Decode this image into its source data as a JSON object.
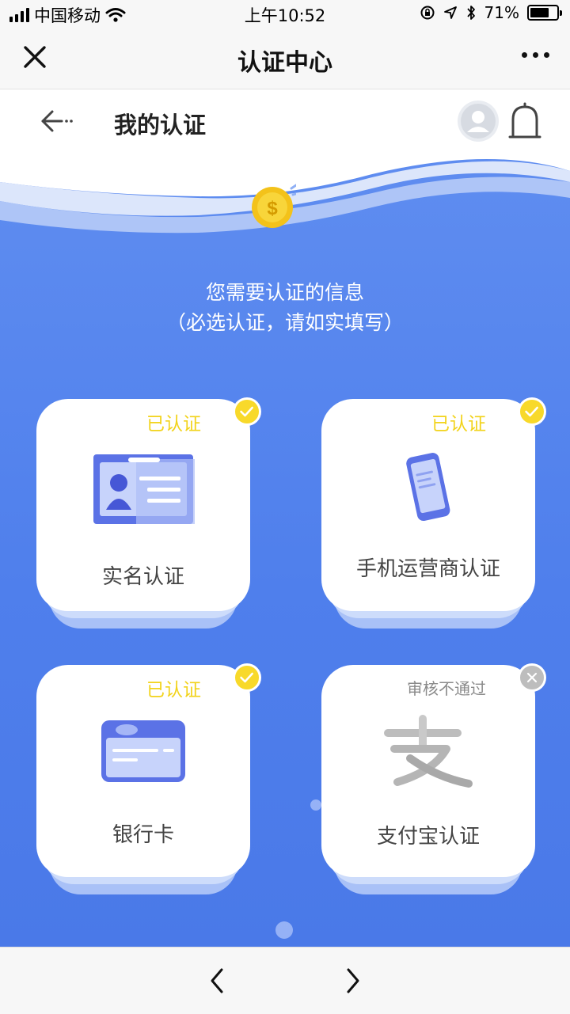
{
  "status_bar": {
    "carrier": "中国移动",
    "time": "上午10:52",
    "battery_pct_text": "71%",
    "battery_level": 0.71
  },
  "navbar": {
    "title": "认证中心"
  },
  "header": {
    "title": "我的认证"
  },
  "hero": {
    "info_line1": "您需要认证的信息",
    "info_line2": "（必选认证，请如实填写）"
  },
  "cards": [
    {
      "label": "实名认证",
      "status": "已认证",
      "status_type": "verified"
    },
    {
      "label": "手机运营商认证",
      "status": "已认证",
      "status_type": "verified"
    },
    {
      "label": "银行卡",
      "status": "已认证",
      "status_type": "verified"
    },
    {
      "label": "支付宝认证",
      "status": "审核不通过",
      "status_type": "rejected"
    }
  ],
  "colors": {
    "accent_blue": "#4f7fec",
    "verified_yellow": "#f8d92a",
    "rejected_gray": "#bdbdbd"
  }
}
